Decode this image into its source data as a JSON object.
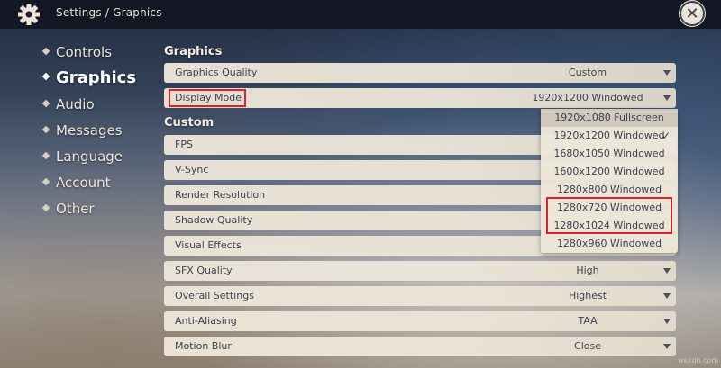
{
  "topbar": {
    "breadcrumb": "Settings / Graphics",
    "close_symbol": "✕"
  },
  "sidebar": {
    "items": [
      {
        "label": "Controls",
        "active": false
      },
      {
        "label": "Graphics",
        "active": true
      },
      {
        "label": "Audio",
        "active": false
      },
      {
        "label": "Messages",
        "active": false
      },
      {
        "label": "Language",
        "active": false
      },
      {
        "label": "Account",
        "active": false
      },
      {
        "label": "Other",
        "active": false
      }
    ]
  },
  "main": {
    "graphics_title": "Graphics",
    "custom_title": "Custom",
    "graphics_rows": [
      {
        "label": "Graphics Quality",
        "value": "Custom"
      },
      {
        "label": "Display Mode",
        "value": "1920x1200 Windowed"
      }
    ],
    "custom_rows": [
      {
        "label": "FPS",
        "value": ""
      },
      {
        "label": "V-Sync",
        "value": ""
      },
      {
        "label": "Render Resolution",
        "value": ""
      },
      {
        "label": "Shadow Quality",
        "value": ""
      },
      {
        "label": "Visual Effects",
        "value": ""
      },
      {
        "label": "SFX Quality",
        "value": "High"
      },
      {
        "label": "Overall Settings",
        "value": "Highest"
      },
      {
        "label": "Anti-Aliasing",
        "value": "TAA"
      },
      {
        "label": "Motion Blur",
        "value": "Close"
      }
    ]
  },
  "dropdown": {
    "options": [
      {
        "label": "1920x1080 Fullscreen",
        "hover": true,
        "selected": false
      },
      {
        "label": "1920x1200 Windowed",
        "hover": false,
        "selected": true
      },
      {
        "label": "1680x1050 Windowed",
        "hover": false,
        "selected": false
      },
      {
        "label": "1600x1200 Windowed",
        "hover": false,
        "selected": false
      },
      {
        "label": "1280x800 Windowed",
        "hover": false,
        "selected": false
      },
      {
        "label": "1280x720 Windowed",
        "hover": false,
        "selected": false
      },
      {
        "label": "1280x1024 Windowed",
        "hover": false,
        "selected": false
      },
      {
        "label": "1280x960 Windowed",
        "hover": false,
        "selected": false
      }
    ],
    "check_symbol": "✓"
  },
  "watermark": "wsxdn.com",
  "colors": {
    "accent_highlight": "#d8232a",
    "panel": "#ece5d8",
    "text_dark": "#3e4352",
    "topbar": "#12162a"
  },
  "icons": {
    "settings": "gear-icon",
    "close": "close-icon",
    "dropdown": "chevron-down-icon",
    "selected": "checkmark-icon"
  }
}
